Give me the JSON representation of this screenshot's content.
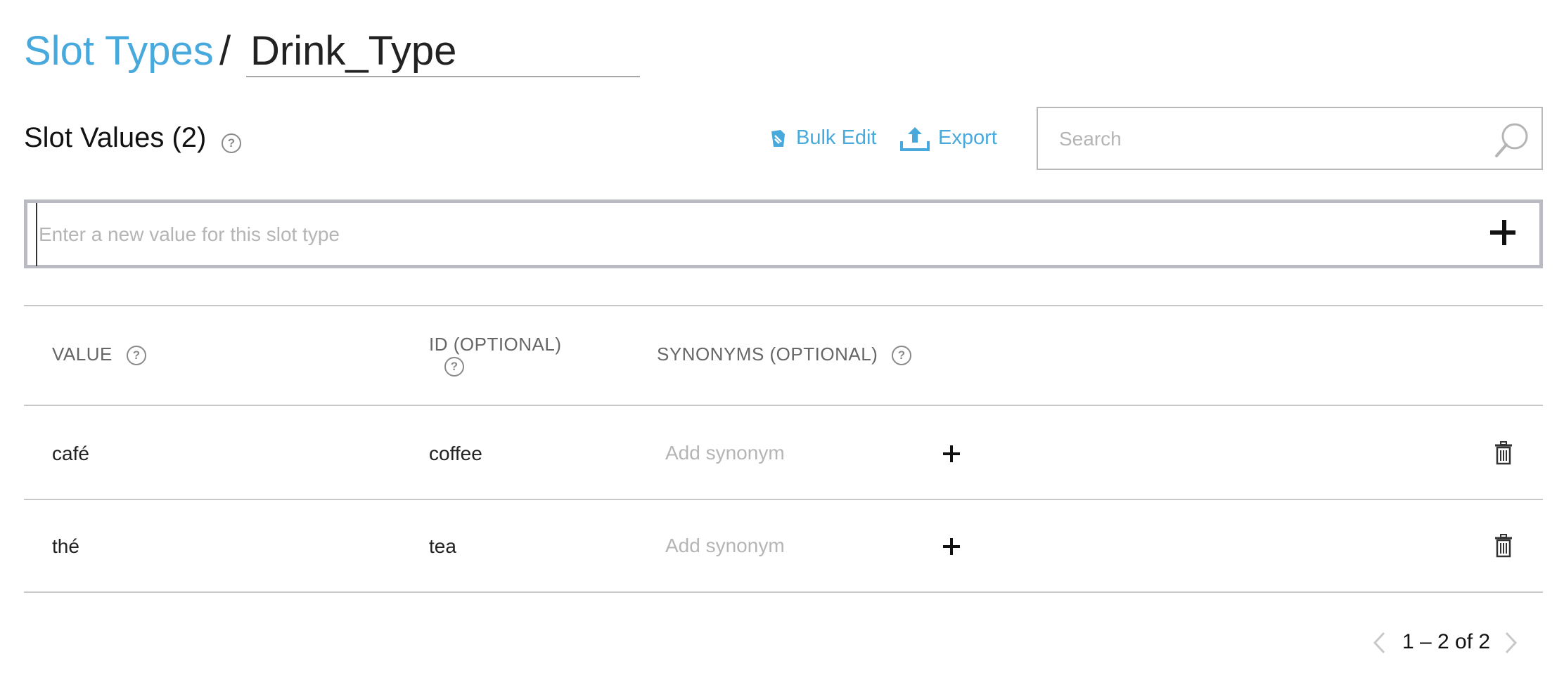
{
  "header": {
    "breadcrumb_link": "Slot Types",
    "separator": "/",
    "slot_type_name": "Drink_Type"
  },
  "section": {
    "title": "Slot Values (2)",
    "help": "?"
  },
  "toolbar": {
    "bulk_edit_label": "Bulk Edit",
    "export_label": "Export"
  },
  "search": {
    "placeholder": "Search",
    "value": ""
  },
  "new_value": {
    "placeholder": "Enter a new value for this slot type",
    "value": ""
  },
  "table": {
    "columns": [
      {
        "label": "VALUE",
        "help": "?"
      },
      {
        "label": "ID (OPTIONAL)",
        "help": "?"
      },
      {
        "label": "SYNONYMS (OPTIONAL)",
        "help": "?"
      }
    ],
    "rows": [
      {
        "value": "café",
        "id": "coffee",
        "synonym_placeholder": "Add synonym"
      },
      {
        "value": "thé",
        "id": "tea",
        "synonym_placeholder": "Add synonym"
      }
    ]
  },
  "pagination": {
    "text": "1 – 2 of 2"
  },
  "colors": {
    "accent": "#48a9dc",
    "text": "#222222",
    "muted": "#666666",
    "placeholder": "#b5b5b5",
    "border": "#c8c8c8"
  },
  "icons": {
    "bulk_edit": "bulk-edit-icon",
    "export": "export-upload-icon",
    "search": "search-icon",
    "add": "plus-icon",
    "delete": "trash-icon",
    "prev": "chevron-left-icon",
    "next": "chevron-right-icon",
    "help": "help-circle-icon"
  }
}
